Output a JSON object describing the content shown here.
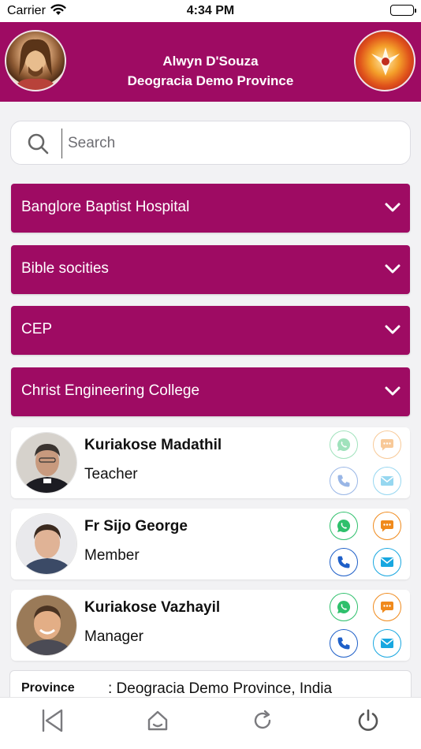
{
  "status_bar": {
    "carrier": "Carrier",
    "time": "4:34 PM"
  },
  "header": {
    "user_name": "Alwyn D'Souza",
    "province": "Deogracia Demo Province",
    "theme_color": "#9e0b63"
  },
  "search": {
    "placeholder": "Search",
    "value": ""
  },
  "groups": [
    {
      "label": "Banglore Baptist Hospital"
    },
    {
      "label": "Bible socities"
    },
    {
      "label": "CEP"
    },
    {
      "label": "Christ Engineering College"
    }
  ],
  "contacts": [
    {
      "name": "Kuriakose Madathil",
      "role": "Teacher"
    },
    {
      "name": "Fr Sijo George",
      "role": "Member"
    },
    {
      "name": "Kuriakose Vazhayil",
      "role": "Manager"
    }
  ],
  "info": {
    "label": "Province",
    "value": ": Deogracia Demo Province, India"
  },
  "icons": {
    "whatsapp": "whatsapp-icon",
    "chat": "chat-icon",
    "phone": "phone-icon",
    "mail": "mail-icon",
    "back": "back-icon",
    "home": "home-icon",
    "refresh": "refresh-icon",
    "power": "power-icon"
  },
  "colors": {
    "whatsapp": "#2fc06c",
    "chat": "#f08a1c",
    "phone": "#1e5fc8",
    "mail": "#18a7e0"
  }
}
